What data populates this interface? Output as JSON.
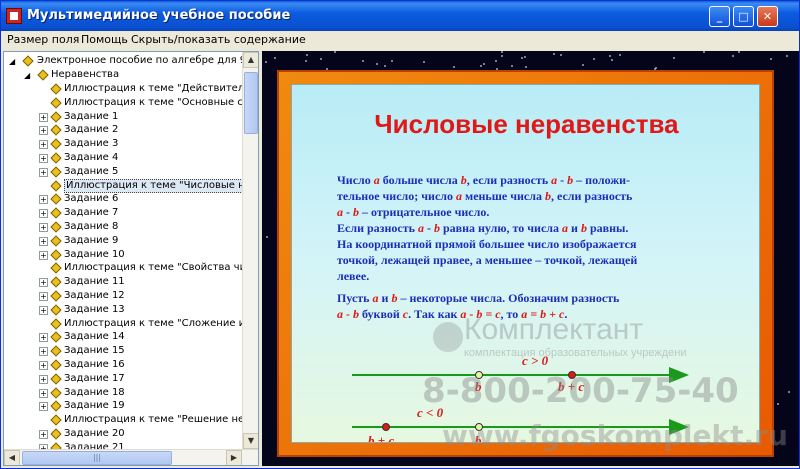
{
  "window": {
    "title": "Мультимедийное учебное пособие",
    "minimize": "_",
    "maximize": "□",
    "close": "✕"
  },
  "menu": {
    "items": [
      "Размер поля",
      "Помощь",
      "Скрыть/показать содержание"
    ]
  },
  "tree": {
    "root": "Электронное пособие по алгебре для 9 кла",
    "section": "Неравенства",
    "items": [
      "Иллюстрация к теме \"Действительнь",
      "Иллюстрация к теме \"Основные свойс",
      "Задание 1",
      "Задание 2",
      "Задание 3",
      "Задание 4",
      "Задание 5",
      "Иллюстрация к теме \"Числовые нера",
      "Задание 6",
      "Задание 7",
      "Задание 8",
      "Задание 9",
      "Задание 10",
      "Иллюстрация к теме \"Свойства числс",
      "Задание 11",
      "Задание 12",
      "Задание 13",
      "Иллюстрация к теме \"Сложение и умн",
      "Задание 14",
      "Задание 15",
      "Задание 16",
      "Задание 17",
      "Задание 18",
      "Задание 19",
      "Иллюстрация к теме \"Решение нерав",
      "Задание 20",
      "Задание 21"
    ],
    "selected_index": 7
  },
  "slide": {
    "title": "Числовые неравенства",
    "p1_parts": [
      "Число ",
      "a",
      " больше числа ",
      "b",
      ", если разность ",
      "a",
      " - ",
      "b",
      " – положи-"
    ],
    "p1_line2": [
      "тельное число; число ",
      "a",
      " меньше числа ",
      "b",
      ", если разность"
    ],
    "p1_line3": [
      "a",
      " - ",
      "b",
      " – отрицательное число."
    ],
    "p2_line1": [
      "Если разность ",
      "a",
      " - ",
      "b",
      " равна нулю, то числа ",
      "a",
      " и ",
      "b",
      " равны."
    ],
    "p2_line2": "На координатной прямой большее число изображается",
    "p2_line3": "точкой, лежащей правее, а меньшее – точкой, лежащей",
    "p2_line4": "левее.",
    "p3_line1": [
      "Пусть ",
      "a",
      " и ",
      "b",
      " – некоторые числа. Обозначим разность"
    ],
    "p3_line2": [
      "a",
      " - ",
      "b",
      " буквой ",
      "c",
      ". Так как ",
      "a",
      " - ",
      "b",
      " = ",
      "c",
      ", то ",
      "a",
      " = ",
      "b",
      " + ",
      "c",
      "."
    ],
    "line1": {
      "condition": "c > 0",
      "left_label": "b",
      "right_label": "b + c"
    },
    "line2": {
      "condition": "c < 0",
      "left_label": "b + c",
      "right_label": "b"
    }
  },
  "watermark": {
    "brand": "Комплектант",
    "tagline": "комплектация образовательных учреждени",
    "phone": "8-800-200-75-40",
    "site": "www.fgoskomplekt.ru"
  },
  "colors": {
    "accent": "#e01818",
    "text_blue": "#1a2fb8",
    "frame_orange": "#f08a10",
    "line_green": "#1a9a1a"
  }
}
